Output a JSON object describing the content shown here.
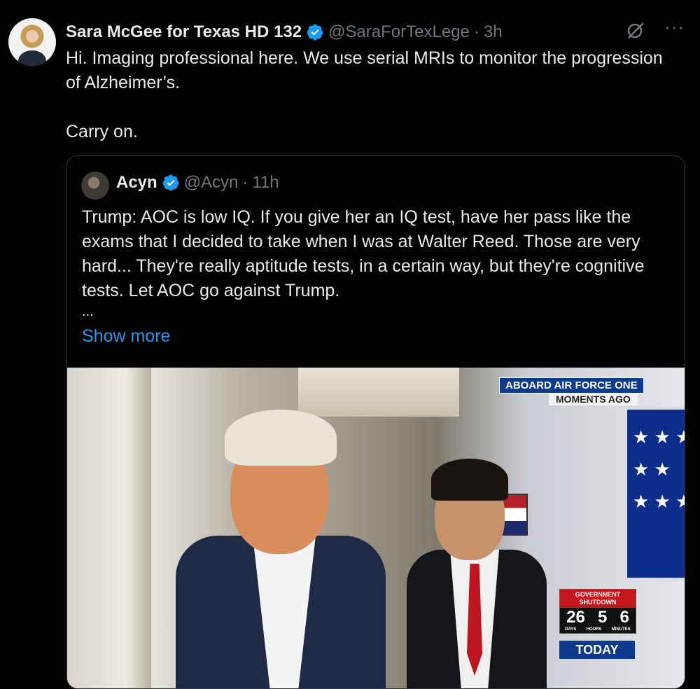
{
  "tweet": {
    "display_name": "Sara McGee for Texas HD 132",
    "handle": "@SaraForTexLege",
    "separator": "·",
    "time": "3h",
    "more_label": "···",
    "text_line1": "Hi. Imaging professional here. We use serial MRIs to monitor the progression of Alzheimer’s.",
    "text_line2": "Carry on."
  },
  "quote": {
    "display_name": "Acyn",
    "handle": "@Acyn",
    "separator": "·",
    "time": "11h",
    "text": "Trump: AOC is low IQ. If you give her an IQ test, have her pass like the exams that I decided to take when I was at Walter Reed. Those are very hard... They're really aptitude tests, in a certain way, but they're cognitive tests. Let AOC go against Trump.",
    "ellipsis": "...",
    "show_more": "Show more"
  },
  "media": {
    "chyron_main": "ABOARD AIR FORCE ONE",
    "chyron_sub": "MOMENTS AGO",
    "counter_title_1": "GOVERNMENT",
    "counter_title_2": "SHUTDOWN",
    "counter_values": [
      "26",
      "5",
      "6"
    ],
    "counter_units": [
      "DAYS",
      "HOURS",
      "MINUTES"
    ],
    "today": "TODAY"
  },
  "colors": {
    "background": "#000000",
    "text": "#e7e9ea",
    "secondary": "#71767b",
    "link": "#1d9bf0",
    "verified": "#1d9bf0"
  },
  "icons": {
    "verified": "verified-badge-icon",
    "grok": "grok-icon",
    "more": "more-icon"
  }
}
